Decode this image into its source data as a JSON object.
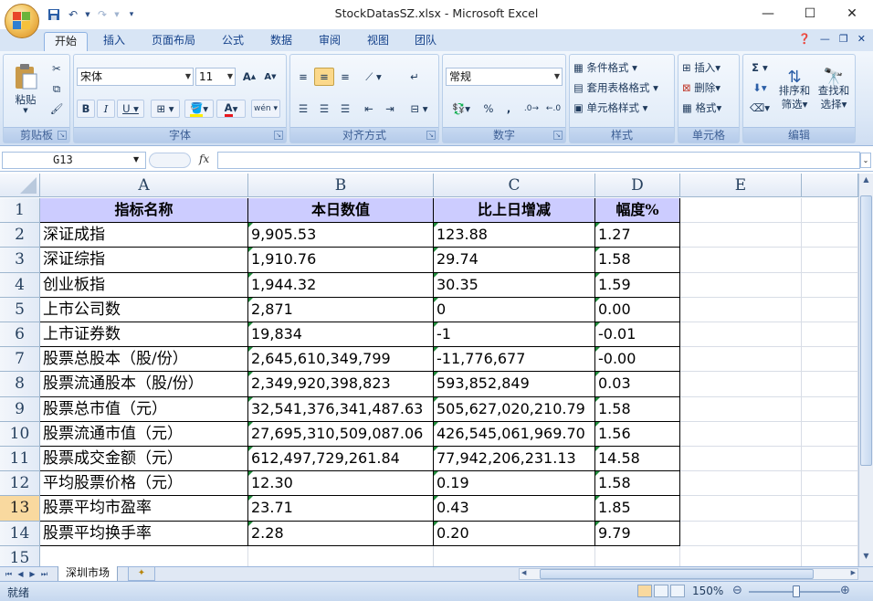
{
  "app": {
    "window_title": "StockDatasSZ.xlsx - Microsoft Excel"
  },
  "ribbon": {
    "tabs": [
      "开始",
      "插入",
      "页面布局",
      "公式",
      "数据",
      "审阅",
      "视图",
      "团队"
    ],
    "clipboard": {
      "label": "剪贴板",
      "paste": "粘贴"
    },
    "font": {
      "label": "字体",
      "font_name": "宋体",
      "font_size": "11"
    },
    "alignment": {
      "label": "对齐方式"
    },
    "number": {
      "label": "数字",
      "format": "常规"
    },
    "styles": {
      "label": "样式",
      "conditional": "条件格式",
      "table": "套用表格格式",
      "cell_styles": "单元格样式"
    },
    "cells": {
      "label": "单元格",
      "insert": "插入",
      "delete": "删除",
      "format": "格式"
    },
    "editing": {
      "label": "编辑",
      "sort": "排序和",
      "sort2": "筛选",
      "find": "查找和",
      "find2": "选择"
    }
  },
  "formula_bar": {
    "name_box": "G13",
    "fx": "fx",
    "value": ""
  },
  "grid": {
    "columns": [
      "A",
      "B",
      "C",
      "D",
      "E"
    ],
    "rows": [
      "1",
      "2",
      "3",
      "4",
      "5",
      "6",
      "7",
      "8",
      "9",
      "10",
      "11",
      "12",
      "13",
      "14",
      "15"
    ],
    "header": [
      "指标名称",
      "本日数值",
      "比上日增减",
      "幅度%"
    ],
    "data": [
      [
        "深证成指",
        "9,905.53",
        "123.88",
        "1.27"
      ],
      [
        "深证综指",
        "1,910.76",
        "29.74",
        "1.58"
      ],
      [
        "创业板指",
        "1,944.32",
        "30.35",
        "1.59"
      ],
      [
        "上市公司数",
        "2,871",
        "0",
        "0.00"
      ],
      [
        "上市证券数",
        "19,834",
        "-1",
        "-0.01"
      ],
      [
        "股票总股本（股/份）",
        "2,645,610,349,799",
        "-11,776,677",
        "-0.00"
      ],
      [
        "股票流通股本（股/份）",
        "2,349,920,398,823",
        "593,852,849",
        "0.03"
      ],
      [
        "股票总市值（元）",
        "32,541,376,341,487.63",
        "505,627,020,210.79",
        "1.58"
      ],
      [
        "股票流通市值（元）",
        "27,695,310,509,087.06",
        "426,545,061,969.70",
        "1.56"
      ],
      [
        "股票成交金额（元）",
        "612,497,729,261.84",
        "77,942,206,231.13",
        "14.58"
      ],
      [
        "平均股票价格（元）",
        "12.30",
        "0.19",
        "1.58"
      ],
      [
        "股票平均市盈率",
        "23.71",
        "0.43",
        "1.85"
      ],
      [
        "股票平均换手率",
        "2.28",
        "0.20",
        "9.79"
      ]
    ]
  },
  "sheets": {
    "active": "深圳市场"
  },
  "status": {
    "text": "就绪",
    "zoom": "150%"
  }
}
